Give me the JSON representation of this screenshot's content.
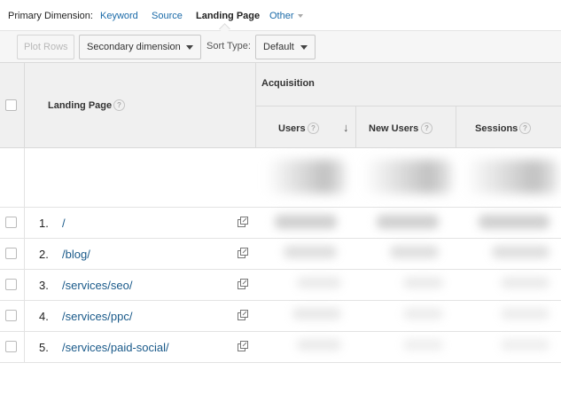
{
  "dimension_bar": {
    "label": "Primary Dimension:",
    "options": [
      {
        "label": "Keyword",
        "active": false
      },
      {
        "label": "Source",
        "active": false
      },
      {
        "label": "Landing Page",
        "active": true
      },
      {
        "label": "Other",
        "active": false
      }
    ]
  },
  "toolbar": {
    "plot_rows": "Plot Rows",
    "secondary_dimension": "Secondary dimension",
    "sort_type_label": "Sort Type:",
    "sort_type_value": "Default"
  },
  "table": {
    "header": {
      "landing_page": "Landing Page",
      "group": "Acquisition",
      "columns": [
        "Users",
        "New Users",
        "Sessions"
      ],
      "help_glyph": "?",
      "sort_icon": "arrow-down-icon"
    },
    "rows": [
      {
        "index": "1.",
        "page": "/"
      },
      {
        "index": "2.",
        "page": "/blog/"
      },
      {
        "index": "3.",
        "page": "/services/seo/"
      },
      {
        "index": "4.",
        "page": "/services/ppc/"
      },
      {
        "index": "5.",
        "page": "/services/paid-social/"
      }
    ]
  },
  "colors": {
    "link": "#1a6aa8",
    "header_bg": "#f0f0f0",
    "toolbar_bg": "#f6f6f6"
  }
}
